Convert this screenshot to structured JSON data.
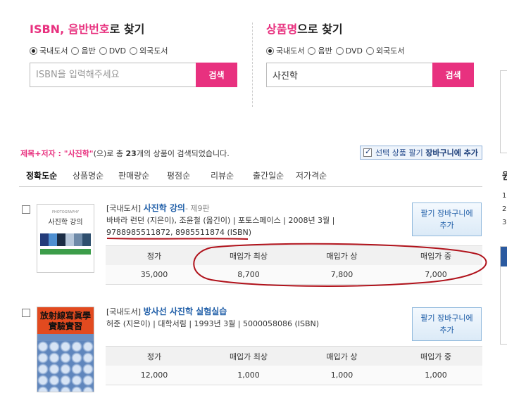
{
  "isbn_search": {
    "title_highlight": "ISBN, 음반번호",
    "title_rest": "로 찾기",
    "radios": [
      "국내도서",
      "음반",
      "DVD",
      "외국도서"
    ],
    "placeholder": "ISBN을 입력해주세요",
    "button": "검색"
  },
  "name_search": {
    "title_highlight": "상품명",
    "title_rest": "으로 찾기",
    "radios": [
      "국내도서",
      "음반",
      "DVD",
      "외국도서"
    ],
    "value": "사진학",
    "button": "검색"
  },
  "summary": {
    "prefix": "제목+저자 : ",
    "query": "\"사진학\"",
    "middle": "(으)로 총 ",
    "count": "23",
    "suffix": "개의 상품이 검색되었습니다."
  },
  "cart_all": {
    "prefix": "선택 상품 팔기 ",
    "strong": "장바구니에 추가"
  },
  "sort_tabs": [
    "정확도순",
    "상품명순",
    "판매량순",
    "평점순",
    "리뷰순",
    "출간일순",
    "저가격순"
  ],
  "price_headers": {
    "list_price": "정가",
    "buy_best": "매입가 최상",
    "buy_good": "매입가 상",
    "buy_mid": "매입가 중"
  },
  "items": [
    {
      "category": "[국내도서]",
      "title": "사진학 강의",
      "edition": "- 제9판",
      "authors": "바바라 런던 (지은이), 조윤철 (옮긴이) | 포토스페이스 | 2008년 3월 |",
      "isbn": "9788985511872, 8985511874 (ISBN)",
      "cover_lines": [
        "PHOTOGRAPHY",
        "사진학 강의"
      ],
      "cart": [
        "팔기 장바구니에",
        "추가"
      ],
      "prices": {
        "list": "35,000",
        "best": "8,700",
        "good": "7,800",
        "mid": "7,000"
      }
    },
    {
      "category": "[국내도서]",
      "title": "방사선 사진학 실험실습",
      "edition": "",
      "authors": "허준 (지은이) | 대학서림 | 1993년 3월 | 5000058086 (ISBN)",
      "isbn": "",
      "cover_lines": [
        "放射線寫眞學",
        "實驗實習"
      ],
      "cart": [
        "팔기 장바구니에",
        "추가"
      ],
      "prices": {
        "list": "12,000",
        "best": "1,000",
        "good": "1,000",
        "mid": "1,000"
      }
    }
  ],
  "edge_chars": [
    "원",
    "1",
    "2",
    "3"
  ],
  "colors": {
    "accent": "#e8317f",
    "link": "#1f5ea8",
    "annotation": "#b0121b"
  }
}
